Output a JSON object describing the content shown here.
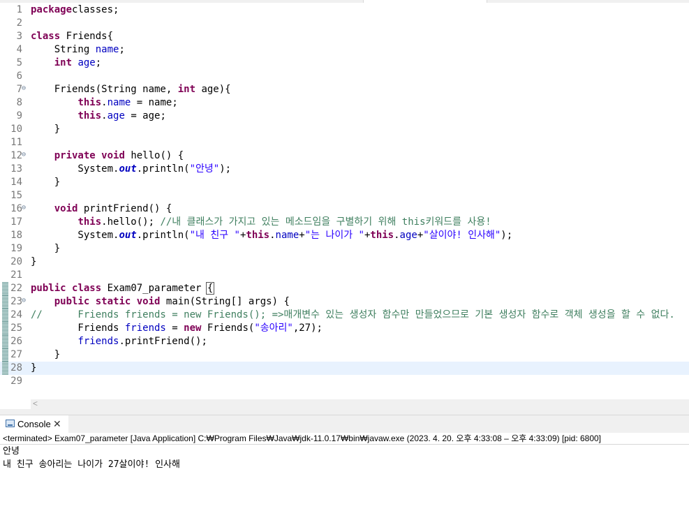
{
  "editor": {
    "lines": [
      {
        "num": "1",
        "parts": [
          [
            "kw",
            "package"
          ],
          [
            "",
            "classes;"
          ]
        ]
      },
      {
        "num": "2",
        "parts": []
      },
      {
        "num": "3",
        "parts": [
          [
            "kw",
            "class"
          ],
          [
            "",
            " Friends{"
          ]
        ]
      },
      {
        "num": "4",
        "parts": [
          [
            "",
            "    String "
          ],
          [
            "fld",
            "name"
          ],
          [
            "",
            ";"
          ]
        ]
      },
      {
        "num": "5",
        "parts": [
          [
            "",
            "    "
          ],
          [
            "kw",
            "int"
          ],
          [
            "",
            " "
          ],
          [
            "fld",
            "age"
          ],
          [
            "",
            ";"
          ]
        ]
      },
      {
        "num": "6",
        "parts": []
      },
      {
        "num": "7",
        "fold": true,
        "parts": [
          [
            "",
            "    Friends(String name, "
          ],
          [
            "kw",
            "int"
          ],
          [
            "",
            " age){"
          ]
        ]
      },
      {
        "num": "8",
        "parts": [
          [
            "",
            "        "
          ],
          [
            "kw",
            "this"
          ],
          [
            "",
            "."
          ],
          [
            "fld",
            "name"
          ],
          [
            "",
            " = name;"
          ]
        ]
      },
      {
        "num": "9",
        "parts": [
          [
            "",
            "        "
          ],
          [
            "kw",
            "this"
          ],
          [
            "",
            "."
          ],
          [
            "fld",
            "age"
          ],
          [
            "",
            " = age;"
          ]
        ]
      },
      {
        "num": "10",
        "parts": [
          [
            "",
            "    }"
          ]
        ]
      },
      {
        "num": "11",
        "parts": []
      },
      {
        "num": "12",
        "fold": true,
        "parts": [
          [
            "",
            "    "
          ],
          [
            "kw",
            "private"
          ],
          [
            "",
            " "
          ],
          [
            "kw",
            "void"
          ],
          [
            "",
            " hello() {"
          ]
        ]
      },
      {
        "num": "13",
        "parts": [
          [
            "",
            "        System."
          ],
          [
            "sfld",
            "out"
          ],
          [
            "",
            ".println("
          ],
          [
            "str",
            "\"안녕\""
          ],
          [
            "",
            ");"
          ]
        ]
      },
      {
        "num": "14",
        "parts": [
          [
            "",
            "    }"
          ]
        ]
      },
      {
        "num": "15",
        "parts": []
      },
      {
        "num": "16",
        "fold": true,
        "parts": [
          [
            "",
            "    "
          ],
          [
            "kw",
            "void"
          ],
          [
            "",
            " printFriend() {"
          ]
        ]
      },
      {
        "num": "17",
        "parts": [
          [
            "",
            "        "
          ],
          [
            "kw",
            "this"
          ],
          [
            "",
            ".hello(); "
          ],
          [
            "cmt",
            "//내 클래스가 가지고 있는 메소드임을 구별하기 위해 this키워드를 사용!"
          ]
        ]
      },
      {
        "num": "18",
        "parts": [
          [
            "",
            "        System."
          ],
          [
            "sfld",
            "out"
          ],
          [
            "",
            ".println("
          ],
          [
            "str",
            "\"내 친구 \""
          ],
          [
            "",
            "+"
          ],
          [
            "kw",
            "this"
          ],
          [
            "",
            "."
          ],
          [
            "fld",
            "name"
          ],
          [
            "",
            "+"
          ],
          [
            "str",
            "\"는 나이가 \""
          ],
          [
            "",
            "+"
          ],
          [
            "kw",
            "this"
          ],
          [
            "",
            "."
          ],
          [
            "fld",
            "age"
          ],
          [
            "",
            "+"
          ],
          [
            "str",
            "\"살이야! 인사해\""
          ],
          [
            "",
            ");"
          ]
        ]
      },
      {
        "num": "19",
        "parts": [
          [
            "",
            "    }"
          ]
        ]
      },
      {
        "num": "20",
        "parts": [
          [
            "",
            "}"
          ]
        ]
      },
      {
        "num": "21",
        "parts": []
      },
      {
        "num": "22",
        "changed": true,
        "parts": [
          [
            "kw",
            "public"
          ],
          [
            "",
            " "
          ],
          [
            "kw",
            "class"
          ],
          [
            "",
            " Exam07_parameter "
          ],
          [
            "hbox",
            "{"
          ]
        ]
      },
      {
        "num": "23",
        "changed": true,
        "fold": true,
        "parts": [
          [
            "",
            "    "
          ],
          [
            "kw",
            "public"
          ],
          [
            "",
            " "
          ],
          [
            "kw",
            "static"
          ],
          [
            "",
            " "
          ],
          [
            "kw",
            "void"
          ],
          [
            "",
            " main(String[] args) {"
          ]
        ]
      },
      {
        "num": "24",
        "changed": true,
        "parts": [
          [
            "cmt",
            "//      Friends friends = new Friends(); =>매개변수 있는 생성자 함수만 만들었으므로 기본 생성자 함수로 객체 생성을 할 수 없다."
          ]
        ]
      },
      {
        "num": "25",
        "changed": true,
        "parts": [
          [
            "",
            "        Friends "
          ],
          [
            "fld",
            "friends"
          ],
          [
            "",
            " = "
          ],
          [
            "kw",
            "new"
          ],
          [
            "",
            " Friends("
          ],
          [
            "str",
            "\"송아리\""
          ],
          [
            "",
            ",27);"
          ]
        ]
      },
      {
        "num": "26",
        "changed": true,
        "parts": [
          [
            "",
            "        "
          ],
          [
            "fld",
            "friends"
          ],
          [
            "",
            ".printFriend();"
          ]
        ]
      },
      {
        "num": "27",
        "changed": true,
        "parts": [
          [
            "",
            "    }"
          ]
        ]
      },
      {
        "num": "28",
        "changed": true,
        "current": true,
        "parts": [
          [
            "",
            "}"
          ]
        ]
      },
      {
        "num": "29",
        "parts": []
      }
    ]
  },
  "console": {
    "tab_label": "Console",
    "status": "<terminated> Exam07_parameter [Java Application] C:₩Program Files₩Java₩jdk-11.0.17₩bin₩javaw.exe  (2023. 4. 20. 오후 4:33:08 – 오후 4:33:09) [pid: 6800]",
    "output": [
      "안녕",
      "내 친구 송아리는 나이가 27살이야! 인사해"
    ]
  },
  "icons": {
    "fold": "collapse-minus-icon",
    "console": "console-icon",
    "close": "close-icon",
    "scroll_left": "scroll-left-arrow-icon"
  }
}
